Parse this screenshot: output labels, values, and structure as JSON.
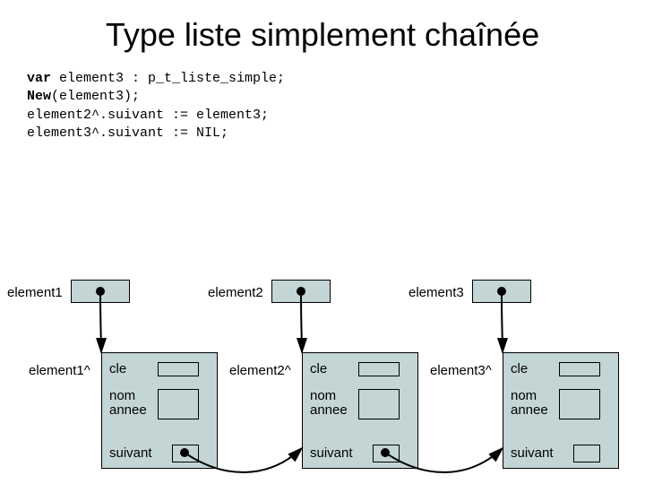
{
  "title": "Type liste simplement chaînée",
  "code": {
    "kw_var": "var",
    "line1_rest": " element3 : p_t_liste_simple;",
    "kw_new": "New",
    "line2_rest": "(element3);",
    "line3": "element2^.suivant := element3;",
    "line4": "element3^.suivant := NIL;"
  },
  "pointers": {
    "p1": "element1",
    "p2": "element2",
    "p3": "element3"
  },
  "derefs": {
    "d1": "element1^",
    "d2": "element2^",
    "d3": "element3^"
  },
  "fields": {
    "cle": "cle",
    "nom": "nom",
    "annee": "annee",
    "suivant": "suivant"
  }
}
